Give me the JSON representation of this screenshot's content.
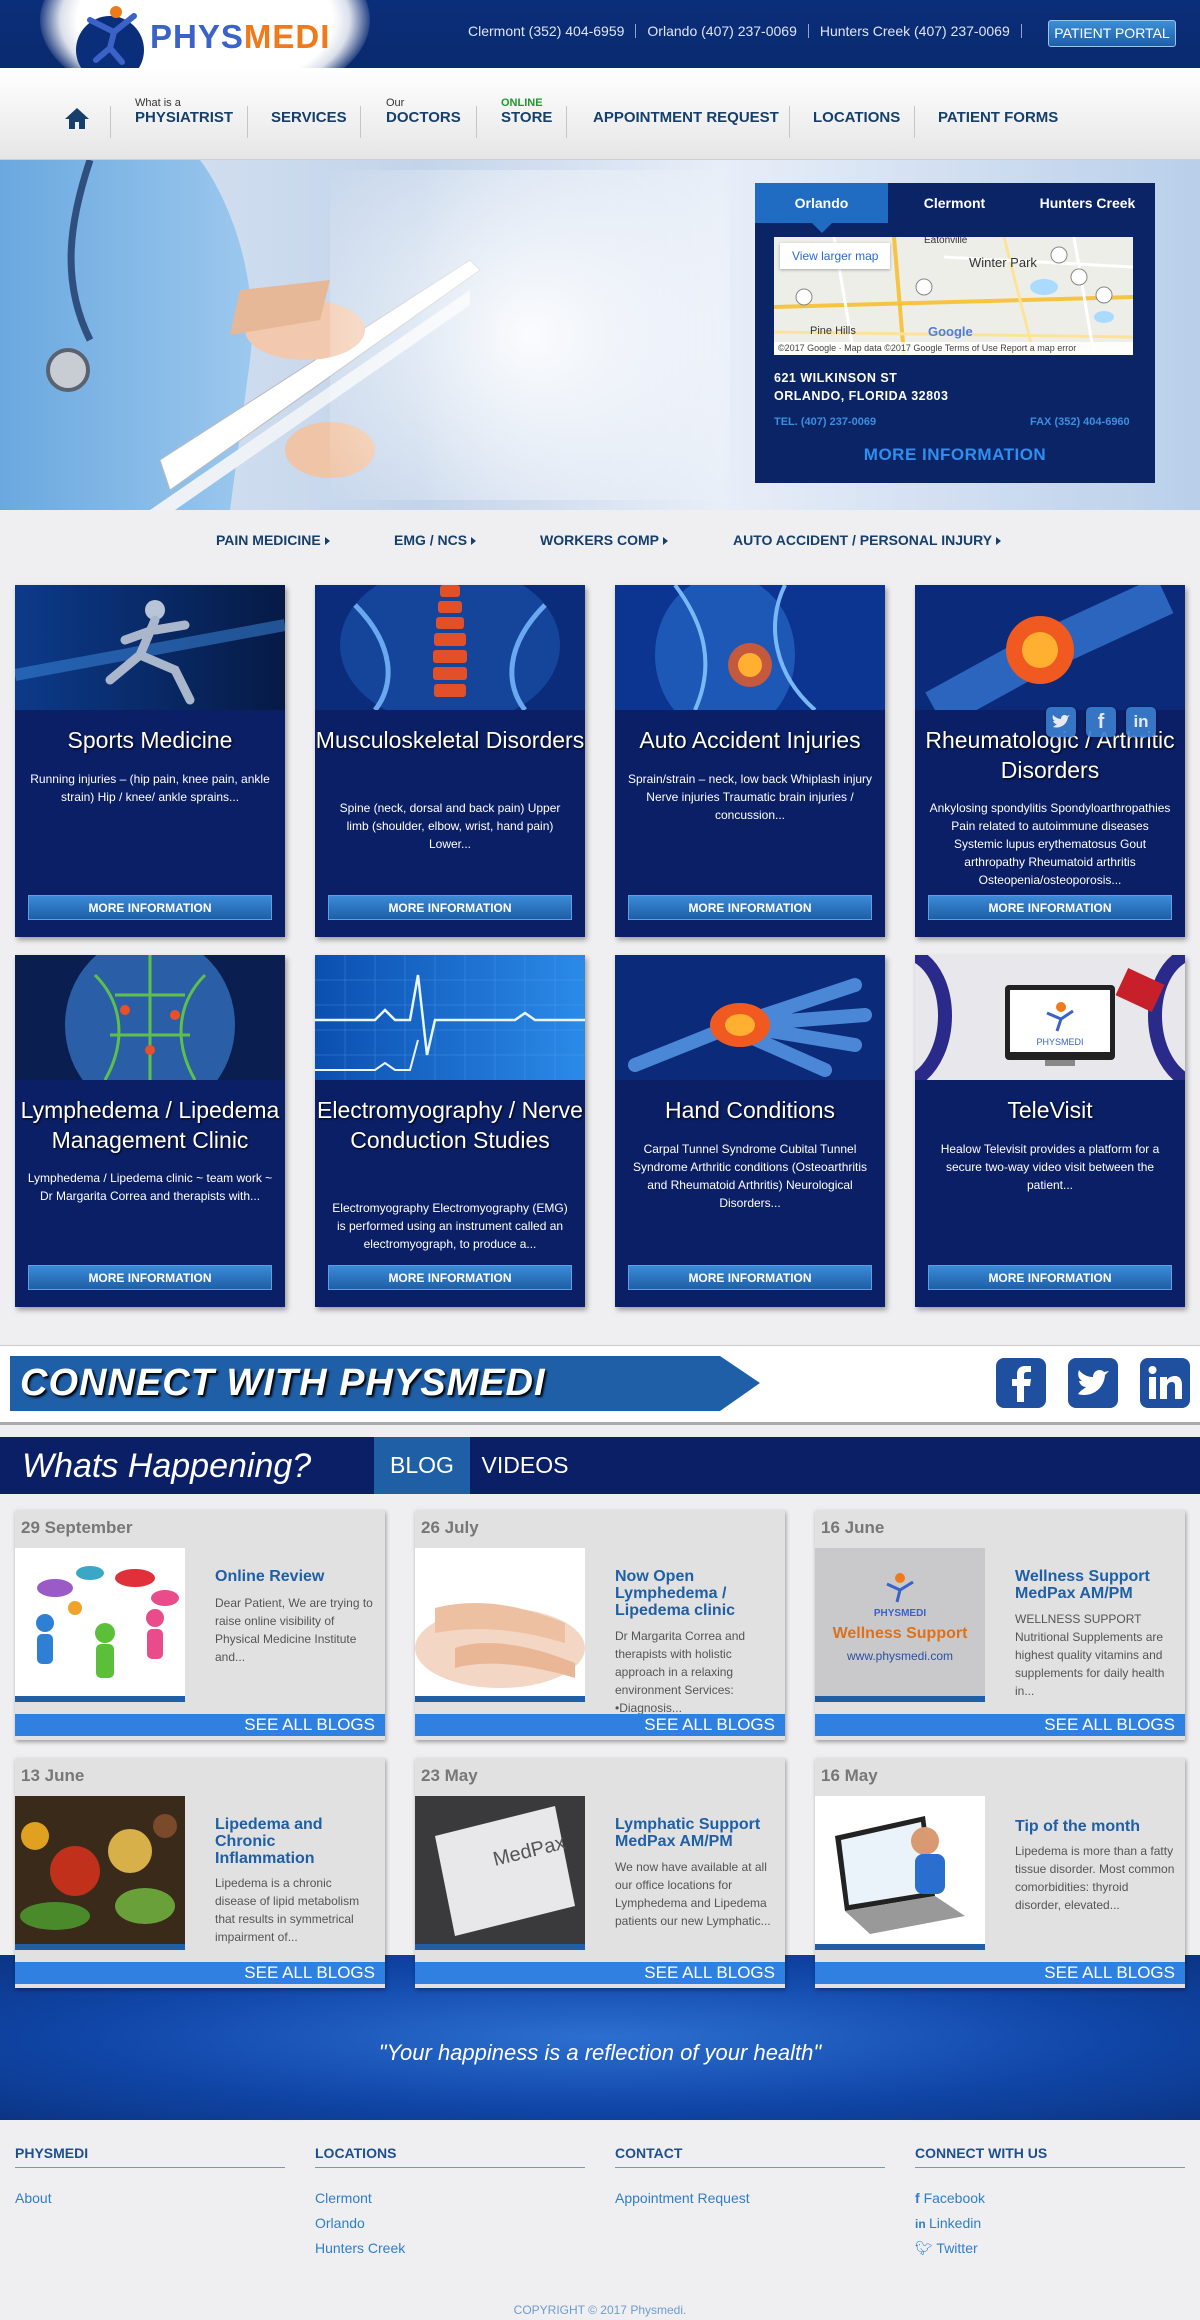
{
  "brand": {
    "name_a": "PHYS",
    "name_b": "MEDI",
    "color_a": "#3a62c7",
    "color_b": "#f07a1a"
  },
  "header": {
    "phones": [
      "Clermont (352) 404-6959",
      "Orlando (407) 237-0069",
      "Hunters Creek (407) 237-0069"
    ],
    "portal_label": "PATIENT PORTAL"
  },
  "nav": {
    "home_icon": "home-icon",
    "items": [
      {
        "small": "What is a",
        "label": "PHYSIATRIST"
      },
      {
        "small": "",
        "label": "SERVICES"
      },
      {
        "small": "Our",
        "label": "DOCTORS"
      },
      {
        "small": "ONLINE",
        "label": "STORE"
      },
      {
        "small": "",
        "label": "APPOINTMENT REQUEST"
      },
      {
        "small": "",
        "label": "LOCATIONS"
      },
      {
        "small": "",
        "label": "PATIENT FORMS"
      }
    ]
  },
  "locations": {
    "tabs": [
      "Orlando",
      "Clermont",
      "Hunters Creek"
    ],
    "active": "Orlando",
    "map_button": "View larger map",
    "map_labels": [
      "Eatonville",
      "Winter Park",
      "Pine Hills",
      "Google"
    ],
    "map_footer": "©2017 Google · Map data ©2017 Google    Terms of Use    Report a map error",
    "address1": "621 WILKINSON ST",
    "address2": "ORLANDO, FLORIDA 32803",
    "tel": "TEL. (407) 237-0069",
    "fax": "FAX (352) 404-6960",
    "more": "MORE INFORMATION"
  },
  "service_links": [
    "PAIN MEDICINE",
    "EMG / NCS",
    "WORKERS COMP",
    "AUTO ACCIDENT / PERSONAL INJURY"
  ],
  "cards": [
    {
      "title": "Sports Medicine",
      "desc": "Running injuries – (hip pain, knee pain, ankle strain) Hip / knee/ ankle sprains...",
      "btn": "MORE INFORMATION"
    },
    {
      "title": "Musculoskeletal Disorders",
      "desc": "Spine (neck, dorsal and back pain) Upper limb (shoulder, elbow, wrist, hand pain) Lower...",
      "btn": "MORE INFORMATION"
    },
    {
      "title": "Auto Accident Injuries",
      "desc": "Sprain/strain – neck, low back Whiplash injury Nerve injuries Traumatic brain injuries / concussion...",
      "btn": "MORE INFORMATION"
    },
    {
      "title": "Rheumatologic / Arthritic Disorders",
      "desc": "Ankylosing spondylitis Spondyloarthropathies Pain related to autoimmune diseases Systemic lupus erythematosus Gout arthropathy Rheumatoid arthritis Osteopenia/osteoporosis...",
      "btn": "MORE INFORMATION"
    },
    {
      "title": "Lymphedema / Lipedema Management Clinic",
      "desc": "Lymphedema / Lipedema clinic ~ team work ~ Dr Margarita Correa and therapists with...",
      "btn": "MORE INFORMATION"
    },
    {
      "title": "Electromyography / Nerve Conduction Studies",
      "desc": "Electromyography Electromyography (EMG) is performed using an instrument called an electromyograph, to produce a...",
      "btn": "MORE INFORMATION"
    },
    {
      "title": "Hand Conditions",
      "desc": "Carpal Tunnel Syndrome Cubital Tunnel Syndrome Arthritic conditions (Osteoarthritis and Rheumatoid Arthritis) Neurological Disorders...",
      "btn": "MORE INFORMATION"
    },
    {
      "title": "TeleVisit",
      "desc": "Healow Televisit provides a platform for a secure two-way video visit between the patient...",
      "btn": "MORE INFORMATION"
    }
  ],
  "connect": {
    "title": "CONNECT WITH PHYSMEDI",
    "icons": [
      "facebook-icon",
      "twitter-icon",
      "linkedin-icon"
    ]
  },
  "happening": {
    "title": "Whats Happening?",
    "tabs": [
      "BLOG",
      "VIDEOS"
    ]
  },
  "blogs": [
    {
      "date": "29 September",
      "title": "Online Review",
      "text": "Dear Patient, We are trying to raise online visibility of Physical Medicine Institute and...",
      "all": "SEE ALL BLOGS"
    },
    {
      "date": "26 July",
      "title": "Now Open Lymphedema / Lipedema clinic",
      "text": "Dr Margarita Correa and therapists with holistic approach in a relaxing environment  Services: •Diagnosis...",
      "all": "SEE ALL BLOGS"
    },
    {
      "date": "16 June",
      "title": "Wellness Support MedPax AM/PM",
      "text": "WELLNESS SUPPORT Nutritional Supplements are highest quality vitamins and supplements for daily health in...",
      "all": "SEE ALL BLOGS"
    },
    {
      "date": "13 June",
      "title": "Lipedema and Chronic Inflammation",
      "text": "Lipedema is a chronic disease of lipid metabolism that results in symmetrical impairment of...",
      "all": "SEE ALL BLOGS"
    },
    {
      "date": "23 May",
      "title": "Lymphatic Support MedPax AM/PM",
      "text": "We now have available at all our office locations for Lymphedema and Lipedema patients our new Lymphatic...",
      "all": "SEE ALL BLOGS"
    },
    {
      "date": "16 May",
      "title": "Tip of the month",
      "text": "Lipedema is more than a fatty tissue disorder. Most common comorbidities: thyroid disorder, elevated...",
      "all": "SEE ALL BLOGS"
    }
  ],
  "blog_image_text": {
    "wellness_brand": "PHYSMEDI",
    "wellness_title": "Wellness Support",
    "wellness_url": "www.physmedi.com",
    "medpax": "MedPax"
  },
  "quote": "\"Your happiness is a reflection of your health\"",
  "footer": {
    "physmedi": {
      "heading": "PHYSMEDI",
      "links": [
        "About"
      ]
    },
    "locations": {
      "heading": "LOCATIONS",
      "links": [
        "Clermont",
        "Orlando",
        "Hunters Creek"
      ]
    },
    "contact": {
      "heading": "CONTACT",
      "links": [
        "Appointment Request"
      ]
    },
    "connect": {
      "heading": "CONNECT WITH US",
      "links": [
        "Facebook",
        "Linkedin",
        "Twitter"
      ]
    },
    "copyright": "COPYRIGHT © 2017 Physmedi."
  }
}
